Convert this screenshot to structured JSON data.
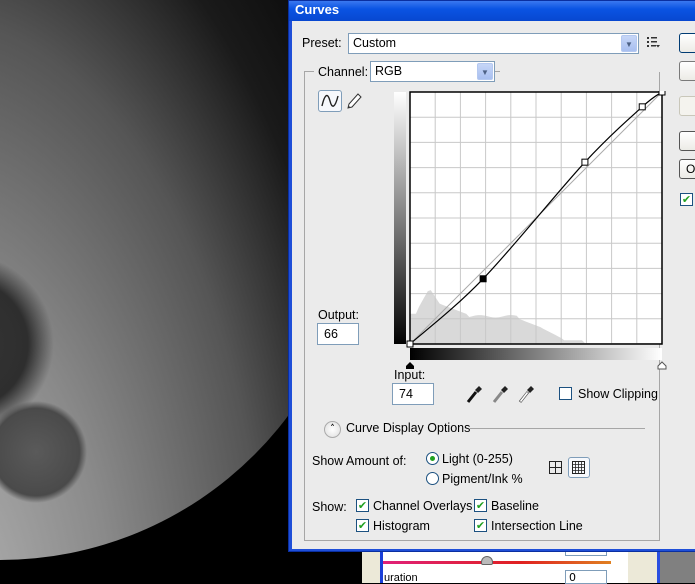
{
  "window": {
    "title": "Curves"
  },
  "preset": {
    "label": "Preset:",
    "value": "Custom",
    "menu_icon": "preset-options-icon"
  },
  "channel": {
    "label": "Channel:",
    "value": "RGB"
  },
  "tools": {
    "curve_tool": "curve-point-tool",
    "pencil_tool": "pencil-tool"
  },
  "output": {
    "label": "Output:",
    "value": "66"
  },
  "input": {
    "label": "Input:",
    "value": "74"
  },
  "curve": {
    "points": [
      [
        0,
        0
      ],
      [
        74,
        66
      ],
      [
        177,
        184
      ],
      [
        235,
        240
      ],
      [
        255,
        255
      ]
    ],
    "selected_index": 1,
    "grid_divisions": 10
  },
  "eyedroppers": [
    "black-point-eyedropper",
    "gray-point-eyedropper",
    "white-point-eyedropper"
  ],
  "show_clipping": {
    "label": "Show Clipping",
    "checked": false
  },
  "display_options": {
    "label": "Curve Display Options"
  },
  "show_amount": {
    "label": "Show Amount of:",
    "options": [
      {
        "label": "Light  (0-255)",
        "selected": true
      },
      {
        "label": "Pigment/Ink %",
        "selected": false
      }
    ]
  },
  "grid_buttons": {
    "simple": "simple-grid",
    "detailed": "detailed-grid",
    "active": "detailed"
  },
  "show": {
    "label": "Show:",
    "options": [
      {
        "label": "Channel Overlays",
        "checked": true
      },
      {
        "label": "Baseline",
        "checked": true
      },
      {
        "label": "Histogram",
        "checked": true
      },
      {
        "label": "Intersection Line",
        "checked": true
      }
    ]
  },
  "right_buttons": {
    "partial_label": "O",
    "partial_checkbox": true
  },
  "background_panel": {
    "partial_label": "uration",
    "value": "0"
  },
  "colors": {
    "titlebar": "#0a54e3",
    "dialog_bg": "#ebebeb",
    "check": "#21a121"
  }
}
